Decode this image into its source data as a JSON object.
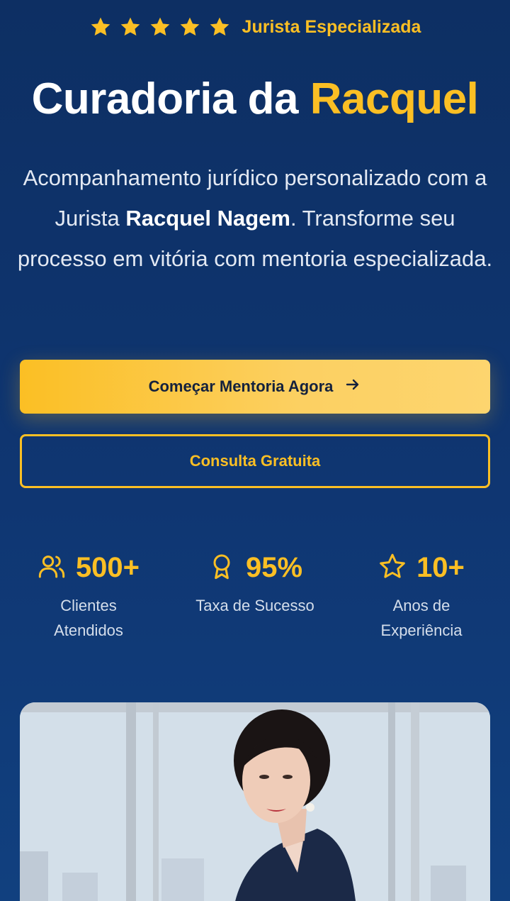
{
  "hero": {
    "rating_label": "Jurista Especializada",
    "star_count": 5,
    "title_main": "Curadoria da ",
    "title_highlight": "Racquel",
    "subtitle_part1": "Acompanhamento jurídico personalizado com a Jurista ",
    "subtitle_name": "Racquel Nagem",
    "subtitle_part2": ". Transforme seu processo em vitória com mentoria especializada."
  },
  "buttons": {
    "primary_label": "Começar Mentoria Agora",
    "secondary_label": "Consulta Gratuita"
  },
  "stats": [
    {
      "icon": "users-icon",
      "value": "500+",
      "label": "Clientes Atendidos"
    },
    {
      "icon": "award-icon",
      "value": "95%",
      "label": "Taxa de Sucesso"
    },
    {
      "icon": "star-outline-icon",
      "value": "10+",
      "label": "Anos de Experiência"
    }
  ],
  "colors": {
    "accent": "#fbbf24",
    "background": "#0f3672",
    "text": "#ffffff"
  }
}
